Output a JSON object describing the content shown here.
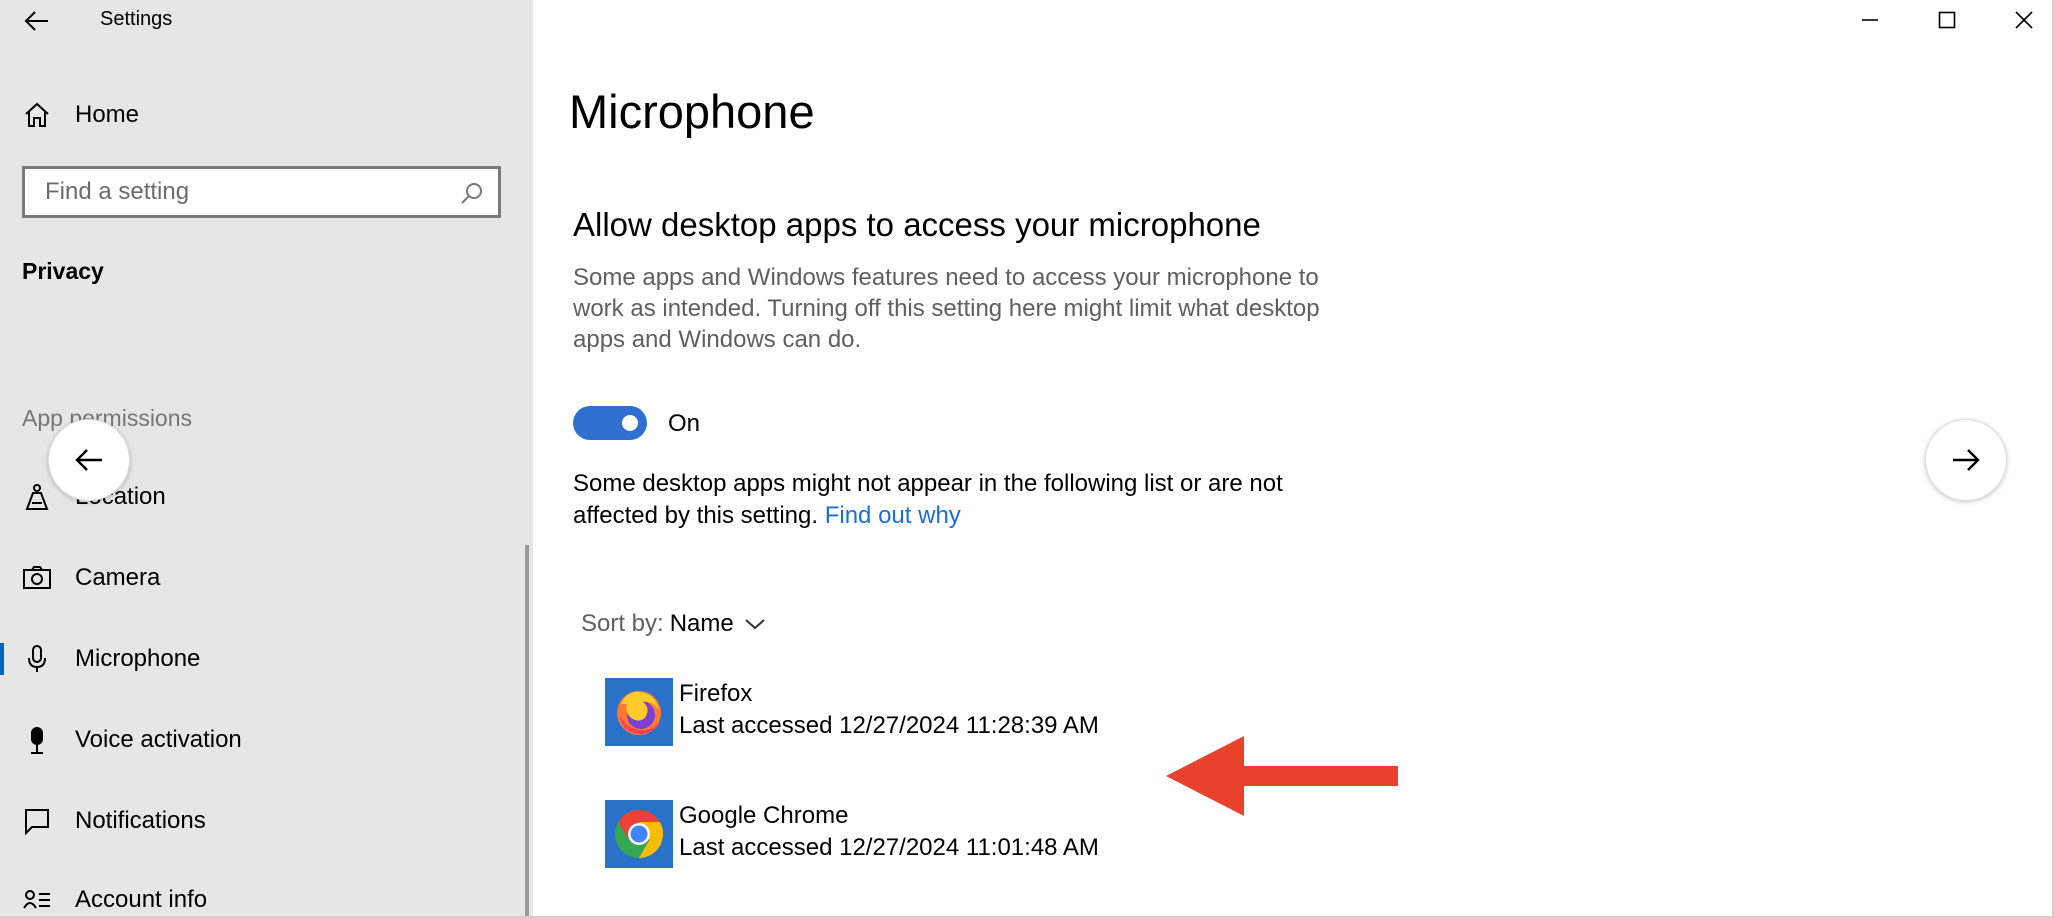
{
  "window": {
    "title": "Settings"
  },
  "sidebar": {
    "home_label": "Home",
    "search_placeholder": "Find a setting",
    "category": "Privacy",
    "group_header": "App permissions",
    "items": [
      {
        "label": "Location",
        "icon": "location-icon"
      },
      {
        "label": "Camera",
        "icon": "camera-icon"
      },
      {
        "label": "Microphone",
        "icon": "microphone-icon",
        "active": true
      },
      {
        "label": "Voice activation",
        "icon": "voice-activation-icon"
      },
      {
        "label": "Notifications",
        "icon": "notifications-icon"
      },
      {
        "label": "Account info",
        "icon": "account-info-icon"
      }
    ]
  },
  "main": {
    "page_title": "Microphone",
    "section_title": "Allow desktop apps to access your microphone",
    "description": "Some apps and Windows features need to access your microphone to work as intended. Turning off this setting here might limit what desktop apps and Windows can do.",
    "toggle": {
      "state": "On",
      "on": true
    },
    "note_text": "Some desktop apps might not appear in the following list or are not affected by this setting.",
    "note_link": "Find out why",
    "sort_label": "Sort by:",
    "sort_value": "Name",
    "apps": [
      {
        "name": "Firefox",
        "last_accessed": "Last accessed 12/27/2024 11:28:39 AM",
        "icon": "firefox-icon"
      },
      {
        "name": "Google Chrome",
        "last_accessed": "Last accessed 12/27/2024 11:01:48 AM",
        "icon": "chrome-icon"
      }
    ]
  },
  "colors": {
    "accent": "#2f6fcf",
    "link": "#1a6fd4",
    "annotation_arrow": "#e8412c",
    "sidebar_bg": "#e6e6e6"
  }
}
